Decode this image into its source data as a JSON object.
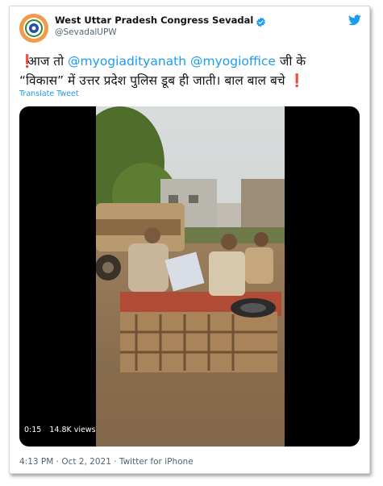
{
  "author": {
    "display_name": "West Uttar Pradesh Congress Sevadal",
    "handle": "@SevadalUPW"
  },
  "icons": {
    "verified": "verified-badge-icon",
    "platform": "twitter-bird-icon",
    "exclamation": "red-exclamation-icon"
  },
  "colors": {
    "mention": "#1d9bf0",
    "exclamation": "#e0245e",
    "verified": "#1d9bf0",
    "secondary_text": "#536471"
  },
  "tweet": {
    "excl_1": "❗",
    "text_1": "आज तो ",
    "mention_1": "@myogiadityanath",
    "text_2": " ",
    "mention_2": "@myogioffice",
    "text_3": " जी के",
    "text_4": "“विकास” में उत्तर प्रदेश पुलिस डूब ही जाती। बाल बाल बचे ",
    "excl_2": "❗"
  },
  "translate_label": "Translate Tweet",
  "video": {
    "time": "0:15",
    "views": "14.8K views"
  },
  "footer": {
    "timestamp": "4:13 PM · Oct 2, 2021 · Twitter for iPhone"
  }
}
